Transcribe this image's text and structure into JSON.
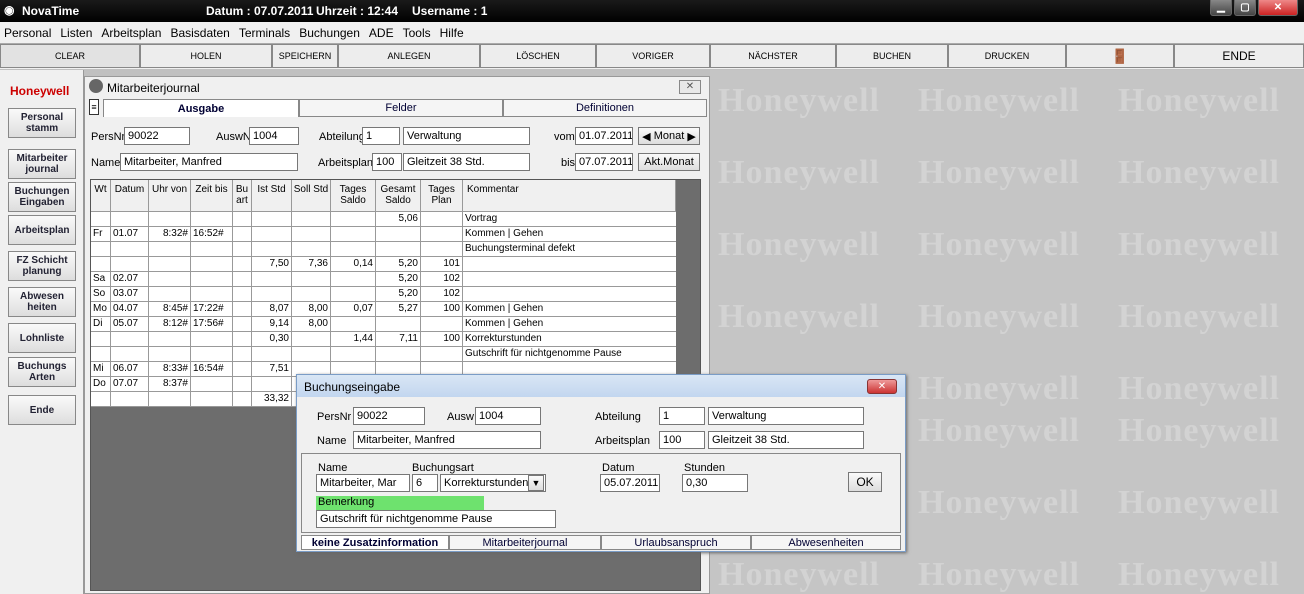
{
  "app": {
    "name": "NovaTime",
    "datum": "Datum : 07.07.2011",
    "uhrzeit": "Uhrzeit : 12:44",
    "username": "Username : 1"
  },
  "menu": [
    "Personal",
    "Listen",
    "Arbeitsplan",
    "Basisdaten",
    "Terminals",
    "Buchungen",
    "ADE",
    "Tools",
    "Hilfe"
  ],
  "toolbar": {
    "clear": "CLEAR",
    "holen": "HOLEN",
    "speichern": "SPEICHERN",
    "anlegen": "ANLEGEN",
    "loeschen": "LÖSCHEN",
    "voriger": "VORIGER",
    "naechster": "NÄCHSTER",
    "buchen": "BUCHEN",
    "drucken": "DRUCKEN",
    "ende": "ENDE"
  },
  "sidebar": {
    "logo": "Honeywell",
    "items": [
      "Personal stamm",
      "Mitarbeiter journal",
      "Buchungen Eingaben",
      "Arbeitsplan",
      "FZ Schicht planung",
      "Abwesen heiten",
      "Lohnliste",
      "Buchungs Arten",
      "Ende"
    ]
  },
  "watermark": "Honeywell",
  "journal": {
    "title": "Mitarbeiterjournal",
    "tabs": [
      "Ausgabe",
      "Felder",
      "Definitionen"
    ],
    "persnr_label": "PersNr",
    "persnr": "90022",
    "auswnr_label": "AuswNr",
    "auswnr": "1004",
    "abteilung_label": "Abteilung",
    "abteilung_nr": "1",
    "abteilung_name": "Verwaltung",
    "vom_label": "vom",
    "vom": "01.07.2011",
    "monat_label": "Monat",
    "name_label": "Name",
    "name": "Mitarbeiter, Manfred",
    "arbeitsplan_label": "Arbeitsplan",
    "arbeitsplan_nr": "100",
    "arbeitsplan_name": "Gleitzeit 38 Std.",
    "bis_label": "bis",
    "bis": "07.07.2011",
    "akt_monat": "Akt.Monat",
    "columns": [
      "Wt",
      "Datum",
      "Uhr von",
      "Zeit bis",
      "Bu art",
      "Ist Std",
      "Soll Std",
      "Tages Saldo",
      "Gesamt Saldo",
      "Tages Plan",
      "Kommentar"
    ],
    "rows": [
      [
        "",
        "",
        "",
        "",
        "",
        "",
        "",
        "",
        "5,06",
        "",
        "Vortrag"
      ],
      [
        "Fr",
        "01.07",
        "8:32#",
        "16:52#",
        "",
        "",
        "",
        "",
        "",
        "",
        "Kommen | Gehen"
      ],
      [
        "",
        "",
        "",
        "",
        "",
        "",
        "",
        "",
        "",
        "",
        "Buchungsterminal defekt"
      ],
      [
        "",
        "",
        "",
        "",
        "",
        "7,50",
        "7,36",
        "0,14",
        "5,20",
        "101",
        ""
      ],
      [
        "Sa",
        "02.07",
        "",
        "",
        "",
        "",
        "",
        "",
        "5,20",
        "102",
        ""
      ],
      [
        "So",
        "03.07",
        "",
        "",
        "",
        "",
        "",
        "",
        "5,20",
        "102",
        ""
      ],
      [
        "Mo",
        "04.07",
        "8:45#",
        "17:22#",
        "",
        "8,07",
        "8,00",
        "0,07",
        "5,27",
        "100",
        "Kommen | Gehen"
      ],
      [
        "Di",
        "05.07",
        "8:12#",
        "17:56#",
        "",
        "9,14",
        "8,00",
        "",
        "",
        "",
        "Kommen | Gehen"
      ],
      [
        "",
        "",
        "",
        "",
        "",
        "0,30",
        "",
        "1,44",
        "7,11",
        "100",
        "Korrekturstunden"
      ],
      [
        "",
        "",
        "",
        "",
        "",
        "",
        "",
        "",
        "",
        "",
        "Gutschrift für nichtgenomme Pause"
      ],
      [
        "Mi",
        "06.07",
        "8:33#",
        "16:54#",
        "",
        "7,51",
        "",
        "",
        "",
        "",
        ""
      ],
      [
        "Do",
        "07.07",
        "8:37#",
        "",
        "",
        "",
        "",
        "",
        "",
        "",
        ""
      ],
      [
        "",
        "",
        "",
        "",
        "",
        "33,32",
        "",
        "",
        "",
        "",
        ""
      ]
    ]
  },
  "dialog": {
    "title": "Buchungseingabe",
    "persnr_label": "PersNr",
    "persnr": "90022",
    "ausw_label": "Ausw",
    "ausw": "1004",
    "abteilung_label": "Abteilung",
    "abteilung_nr": "1",
    "abteilung_name": "Verwaltung",
    "name_label": "Name",
    "name": "Mitarbeiter, Manfred",
    "arbeitsplan_label": "Arbeitsplan",
    "arbeitsplan_nr": "100",
    "arbeitsplan_name": "Gleitzeit 38 Std.",
    "name2_label": "Name",
    "name2": "Mitarbeiter, Mar",
    "buchungsart_label": "Buchungsart",
    "buchungsart_nr": "6",
    "buchungsart_name": "Korrekturstunden",
    "datum_label": "Datum",
    "datum": "05.07.2011",
    "stunden_label": "Stunden",
    "stunden": "0,30",
    "ok": "OK",
    "bemerkung_label": "Bemerkung",
    "bemerkung": "Gutschrift für nichtgenomme Pause",
    "tabs": [
      "keine Zusatzinformation",
      "Mitarbeiterjournal",
      "Urlaubsanspruch",
      "Abwesenheiten"
    ]
  }
}
